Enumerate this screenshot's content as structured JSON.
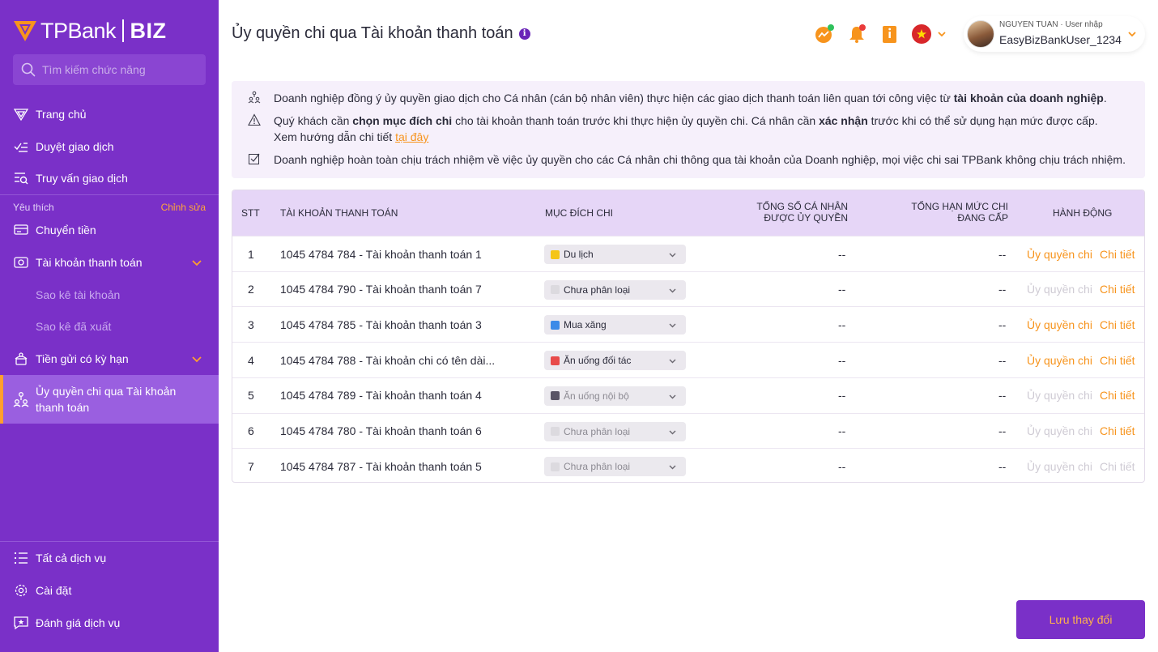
{
  "brand": {
    "name": "TPBank",
    "product": "BIZ",
    "accent": "#7a30c8",
    "highlight": "#f7941d"
  },
  "sidebar": {
    "search_placeholder": "Tìm kiếm chức năng",
    "main_items": [
      {
        "label": "Trang chủ",
        "icon": "home-icon"
      },
      {
        "label": "Duyệt giao dịch",
        "icon": "approve-icon"
      },
      {
        "label": "Truy vấn giao dịch",
        "icon": "query-icon"
      }
    ],
    "favorites_label": "Yêu thích",
    "favorites_edit": "Chỉnh sửa",
    "fav_items": [
      {
        "label": "Chuyển tiền",
        "icon": "transfer-icon"
      },
      {
        "label": "Tài khoản thanh toán",
        "icon": "account-icon"
      }
    ],
    "sub_items": [
      "Sao kê tài khoản",
      "Sao kê đã xuất"
    ],
    "deposit_item": "Tiền gửi có kỳ hạn",
    "active_item": "Ủy quyền chi qua Tài khoản thanh toán",
    "bottom_items": [
      {
        "label": "Tất cả dịch vụ",
        "icon": "list-icon"
      },
      {
        "label": "Cài đặt",
        "icon": "settings-icon"
      },
      {
        "label": "Đánh giá dịch vụ",
        "icon": "feedback-icon"
      }
    ]
  },
  "header": {
    "title": "Ủy quyền chi qua Tài khoản thanh toán",
    "info": "i",
    "user_role": "NGUYEN TUAN · User nhập",
    "user_name": "EasyBizBankUser_1234"
  },
  "notice": {
    "line1_pre": "Doanh nghiệp đồng ý ủy quyền giao dịch cho Cá nhân (cán bộ nhân viên) thực hiện các giao dịch thanh toán liên quan tới công việc từ ",
    "line1_bold": "tài khoản của doanh nghiệp",
    "line1_post": ".",
    "line2_a": "Quý khách cần ",
    "line2_b": "chọn mục đích chi",
    "line2_c": " cho tài khoản thanh toán trước khi thực hiện ủy quyền chi. Cá nhân cần ",
    "line2_d": "xác nhận",
    "line2_e": " trước khi có thể sử dụng hạn mức được cấp. Xem hướng dẫn chi tiết ",
    "line2_link": "tại đây",
    "line3": "Doanh nghiệp hoàn toàn chịu trách nhiệm về việc ủy quyền cho các Cá nhân chi thông qua tài khoản của Doanh nghiệp, mọi việc chi sai TPBank không chịu trách nhiệm."
  },
  "table": {
    "headers": {
      "stt": "STT",
      "account": "TÀI KHOẢN THANH TOÁN",
      "purpose": "MỤC ĐÍCH CHI",
      "total_people": "TỔNG SỐ CÁ NHÂN ĐƯỢC ỦY QUYỀN",
      "total_limit": "TỔNG HẠN MỨC CHI ĐANG CẤP",
      "action": "HÀNH ĐỘNG"
    },
    "action_labels": {
      "authorize": "Ủy quyền chi",
      "detail": "Chi tiết"
    },
    "rows": [
      {
        "stt": "1",
        "account": "1045 4784 784 - Tài khoản thanh toán 1",
        "purpose": "Du lịch",
        "color": "#f5c518",
        "people": "--",
        "limit": "--",
        "authorize": true,
        "detail": true,
        "disabled": false
      },
      {
        "stt": "2",
        "account": "1045 4784 790 - Tài khoản thanh toán 7",
        "purpose": "Chưa phân loại",
        "color": "#dcdadf",
        "people": "--",
        "limit": "--",
        "authorize": false,
        "detail": true,
        "disabled": false
      },
      {
        "stt": "3",
        "account": "1045 4784 785 - Tài khoản thanh toán 3",
        "purpose": "Mua xăng",
        "color": "#3d8be8",
        "people": "--",
        "limit": "--",
        "authorize": true,
        "detail": true,
        "disabled": false
      },
      {
        "stt": "4",
        "account": "1045 4784 788 - Tài khoản chi có tên dài...",
        "purpose": "Ăn uống đối tác",
        "color": "#e84a4a",
        "people": "--",
        "limit": "--",
        "authorize": true,
        "detail": true,
        "disabled": false
      },
      {
        "stt": "5",
        "account": "1045 4784 789 - Tài khoản thanh toán 4",
        "purpose": "Ăn uống nội bộ",
        "color": "#5a5566",
        "people": "--",
        "limit": "--",
        "authorize": false,
        "detail": true,
        "disabled": true
      },
      {
        "stt": "6",
        "account": "1045 4784 780 - Tài khoản thanh toán 6",
        "purpose": "Chưa phân loại",
        "color": "#dcdadf",
        "people": "--",
        "limit": "--",
        "authorize": false,
        "detail": true,
        "disabled": true
      },
      {
        "stt": "7",
        "account": "1045 4784 787 - Tài khoản thanh toán 5",
        "purpose": "Chưa phân loại",
        "color": "#dcdadf",
        "people": "--",
        "limit": "--",
        "authorize": false,
        "detail": false,
        "disabled": true
      }
    ]
  },
  "save_label": "Lưu thay đổi"
}
